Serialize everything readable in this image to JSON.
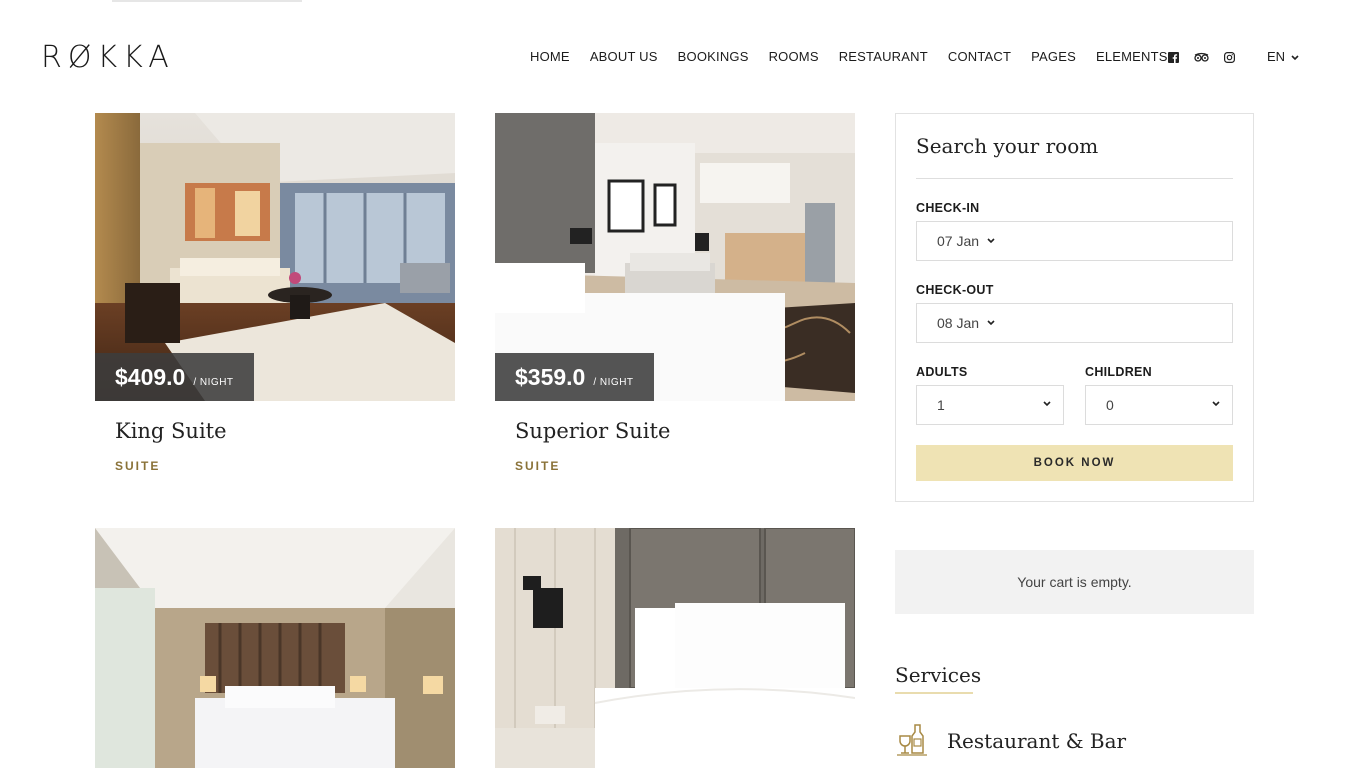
{
  "brand": {
    "logo": "RØKKA"
  },
  "nav": {
    "items": [
      "HOME",
      "ABOUT US",
      "BOOKINGS",
      "ROOMS",
      "RESTAURANT",
      "CONTACT",
      "PAGES",
      "ELEMENTS"
    ],
    "language": "EN"
  },
  "social": [
    "facebook-icon",
    "tripadvisor-icon",
    "instagram-icon"
  ],
  "rooms": [
    {
      "name": "King Suite",
      "type": "SUITE",
      "price": "$409.0",
      "per": "/ NIGHT"
    },
    {
      "name": "Superior Suite",
      "type": "SUITE",
      "price": "$359.0",
      "per": "/ NIGHT"
    }
  ],
  "booking": {
    "title": "Search your room",
    "checkin_label": "CHECK-IN",
    "checkin_value": "07 Jan",
    "checkout_label": "CHECK-OUT",
    "checkout_value": "08 Jan",
    "adults_label": "ADULTS",
    "adults_value": "1",
    "children_label": "CHILDREN",
    "children_value": "0",
    "button": "BOOK NOW"
  },
  "cart": {
    "text": "Your cart is empty."
  },
  "services": {
    "title": "Services",
    "items": [
      {
        "label": "Restaurant & Bar",
        "icon": "wine-bottle-glass-icon"
      }
    ]
  },
  "colors": {
    "accent": "#efe3b4",
    "type_label": "#8a7238",
    "price_overlay": "#3c3c3c"
  }
}
